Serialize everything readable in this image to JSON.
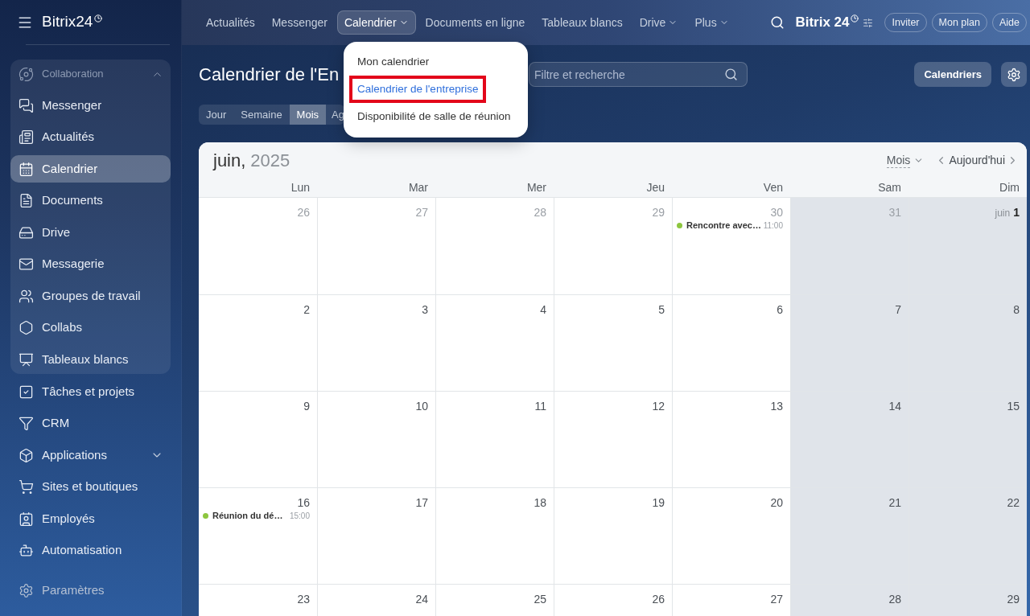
{
  "app": {
    "logo": "Bitrix24"
  },
  "sidebar": {
    "group": {
      "label": "Collaboration",
      "expanded": true,
      "items": [
        {
          "label": "Messenger",
          "selected": false
        },
        {
          "label": "Actualités",
          "selected": false
        },
        {
          "label": "Calendrier",
          "selected": true
        },
        {
          "label": "Documents",
          "selected": false
        },
        {
          "label": "Drive",
          "selected": false
        },
        {
          "label": "Messagerie",
          "selected": false
        },
        {
          "label": "Groupes de travail",
          "selected": false
        },
        {
          "label": "Collabs",
          "selected": false
        },
        {
          "label": "Tableaux blancs",
          "selected": false
        }
      ]
    },
    "items": [
      {
        "label": "Tâches et projets",
        "selected": false,
        "has_submenu": false
      },
      {
        "label": "CRM",
        "selected": false,
        "has_submenu": false
      },
      {
        "label": "Applications",
        "selected": false,
        "has_submenu": true
      },
      {
        "label": "Sites et boutiques",
        "selected": false,
        "has_submenu": false
      },
      {
        "label": "Employés",
        "selected": false,
        "has_submenu": false
      },
      {
        "label": "Automatisation",
        "selected": false,
        "has_submenu": false
      }
    ],
    "settings": {
      "label": "Paramètres"
    }
  },
  "top_bar": {
    "nav": [
      {
        "label": "Actualités",
        "selected": false,
        "has_menu": false
      },
      {
        "label": "Messenger",
        "selected": false,
        "has_menu": false
      },
      {
        "label": "Calendrier",
        "selected": true,
        "has_menu": true
      },
      {
        "label": "Documents en ligne",
        "selected": false,
        "has_menu": false
      },
      {
        "label": "Tableaux blancs",
        "selected": false,
        "has_menu": false
      },
      {
        "label": "Drive",
        "selected": false,
        "has_menu": true
      },
      {
        "label": "Plus",
        "selected": false,
        "has_menu": true
      }
    ],
    "logo": "Bitrix 24",
    "buttons": [
      "Inviter",
      "Mon plan",
      "Aide"
    ]
  },
  "nav_dropdown": {
    "items": [
      {
        "label": "Mon calendrier",
        "selected": false,
        "highlighted": false
      },
      {
        "label": "Calendrier de l'entreprise",
        "selected": true,
        "highlighted": true
      },
      {
        "label": "Disponibilité de salle de réunion",
        "selected": false,
        "highlighted": false
      }
    ]
  },
  "page": {
    "title": "Calendrier de l'En",
    "search": {
      "placeholder": "Filtre et recherche"
    },
    "calendars_button": "Calendriers",
    "view_tabs": [
      {
        "label": "Jour",
        "selected": false
      },
      {
        "label": "Semaine",
        "selected": false
      },
      {
        "label": "Mois",
        "selected": true
      },
      {
        "label": "Ag",
        "selected": false
      }
    ]
  },
  "calendar": {
    "month": "juin,",
    "year": "2025",
    "view_select": "Mois",
    "today_button": "Aujourd'hui",
    "weekdays": [
      "Lun",
      "Mar",
      "Mer",
      "Jeu",
      "Ven",
      "Sam",
      "Dim"
    ],
    "weeks": [
      {
        "days": [
          {
            "day": "26",
            "other_month": true,
            "weekend": false
          },
          {
            "day": "27",
            "other_month": true,
            "weekend": false
          },
          {
            "day": "28",
            "other_month": true,
            "weekend": false
          },
          {
            "day": "29",
            "other_month": true,
            "weekend": false
          },
          {
            "day": "30",
            "other_month": true,
            "weekend": false,
            "events": [
              {
                "title": "Rencontre avec…",
                "time": "11:00",
                "color": "#8dc63f"
              }
            ]
          },
          {
            "day": "31",
            "other_month": true,
            "weekend": true
          },
          {
            "day": "1",
            "month_label": "juin",
            "other_month": false,
            "weekend": true
          }
        ]
      },
      {
        "days": [
          {
            "day": "2",
            "other_month": false,
            "weekend": false
          },
          {
            "day": "3",
            "other_month": false,
            "weekend": false
          },
          {
            "day": "4",
            "other_month": false,
            "weekend": false
          },
          {
            "day": "5",
            "other_month": false,
            "weekend": false
          },
          {
            "day": "6",
            "other_month": false,
            "weekend": false
          },
          {
            "day": "7",
            "other_month": false,
            "weekend": true
          },
          {
            "day": "8",
            "other_month": false,
            "weekend": true
          }
        ]
      },
      {
        "days": [
          {
            "day": "9",
            "other_month": false,
            "weekend": false
          },
          {
            "day": "10",
            "other_month": false,
            "weekend": false
          },
          {
            "day": "11",
            "other_month": false,
            "weekend": false
          },
          {
            "day": "12",
            "other_month": false,
            "weekend": false
          },
          {
            "day": "13",
            "other_month": false,
            "weekend": false
          },
          {
            "day": "14",
            "other_month": false,
            "weekend": true
          },
          {
            "day": "15",
            "other_month": false,
            "weekend": true
          }
        ]
      },
      {
        "days": [
          {
            "day": "16",
            "other_month": false,
            "weekend": false,
            "events": [
              {
                "title": "Réunion du dé…",
                "time": "15:00",
                "color": "#8dc63f"
              }
            ]
          },
          {
            "day": "17",
            "other_month": false,
            "weekend": false
          },
          {
            "day": "18",
            "other_month": false,
            "weekend": false
          },
          {
            "day": "19",
            "other_month": false,
            "weekend": false
          },
          {
            "day": "20",
            "other_month": false,
            "weekend": false
          },
          {
            "day": "21",
            "other_month": false,
            "weekend": true
          },
          {
            "day": "22",
            "other_month": false,
            "weekend": true
          }
        ]
      },
      {
        "days": [
          {
            "day": "23",
            "other_month": false,
            "weekend": false
          },
          {
            "day": "24",
            "other_month": false,
            "weekend": false
          },
          {
            "day": "25",
            "other_month": false,
            "weekend": false
          },
          {
            "day": "26",
            "other_month": false,
            "weekend": false
          },
          {
            "day": "27",
            "other_month": false,
            "weekend": false
          },
          {
            "day": "28",
            "other_month": false,
            "weekend": true
          },
          {
            "day": "29",
            "other_month": false,
            "weekend": true
          }
        ]
      }
    ]
  }
}
